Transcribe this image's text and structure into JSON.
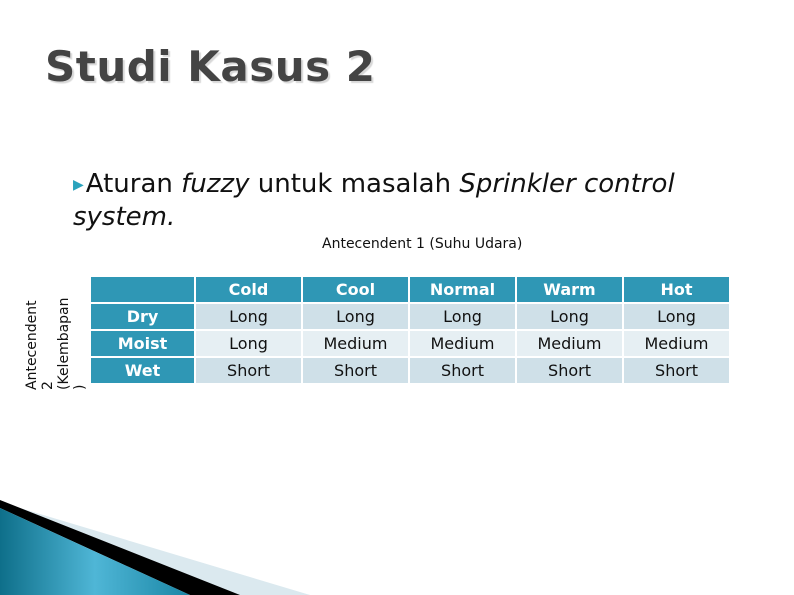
{
  "slide": {
    "title": "Studi Kasus 2",
    "bullet": {
      "icon": "bullet-arrow-icon",
      "parts": [
        "Aturan ",
        "fuzzy",
        " untuk masalah ",
        "Sprinkler control system."
      ]
    },
    "antecedent1_label": "Antecendent 1 (Suhu Udara)",
    "antecedent2_lines": [
      "Antecendent",
      "2",
      "(Kelembapan",
      ")"
    ]
  },
  "table": {
    "columns": [
      "",
      "Cold",
      "Cool",
      "Normal",
      "Warm",
      "Hot"
    ],
    "rows": [
      {
        "label": "Dry",
        "values": [
          "Long",
          "Long",
          "Long",
          "Long",
          "Long"
        ]
      },
      {
        "label": "Moist",
        "values": [
          "Long",
          "Medium",
          "Medium",
          "Medium",
          "Medium"
        ]
      },
      {
        "label": "Wet",
        "values": [
          "Short",
          "Short",
          "Short",
          "Short",
          "Short"
        ]
      }
    ]
  },
  "colors": {
    "accent": "#2f97b5",
    "title": "#444444",
    "row_light": "#e6eff3",
    "row_dark": "#cfe0e8"
  }
}
